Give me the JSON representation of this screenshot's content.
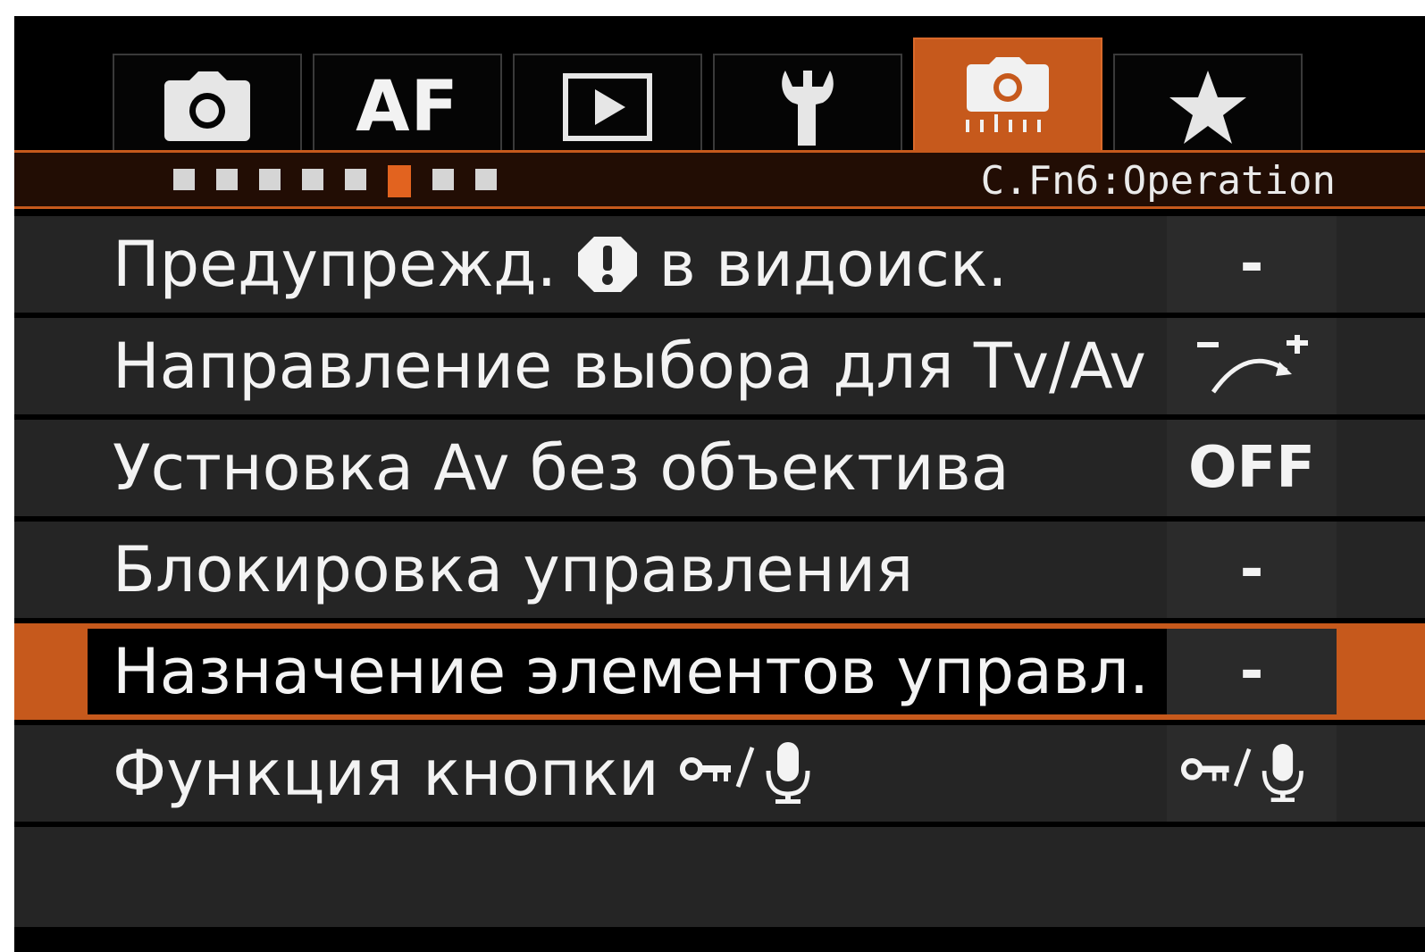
{
  "tabs": [
    {
      "icon": "camera-icon",
      "active": false
    },
    {
      "label": "AF",
      "active": false
    },
    {
      "icon": "playback-icon",
      "active": false
    },
    {
      "icon": "wrench-icon",
      "active": false
    },
    {
      "icon": "custom-function-camera-icon",
      "active": true
    },
    {
      "icon": "star-icon",
      "active": false
    }
  ],
  "header": {
    "page_count": 8,
    "active_page": 6,
    "title": "C.Fn6:Operation"
  },
  "items": [
    {
      "label_pre": "Предупрежд.",
      "label_post": "в видоиск.",
      "label_icon": "exclamation-icon",
      "value": "-"
    },
    {
      "label": "Направление выбора для Tv/Av",
      "value_icon": "dial-direction-icon"
    },
    {
      "label": "Устновка Av без объектива",
      "value": "OFF"
    },
    {
      "label": "Блокировка управления",
      "value": "-"
    },
    {
      "label": "Назначение элементов управл.",
      "value": "-",
      "selected": true
    },
    {
      "label": "Функция кнопки",
      "label_icon": "lock-mic-icon",
      "value_icon": "lock-mic-icon"
    }
  ],
  "colors": {
    "accent": "#c6591c",
    "background": "#000000",
    "row": "#252525",
    "text": "#f3f3f3"
  }
}
